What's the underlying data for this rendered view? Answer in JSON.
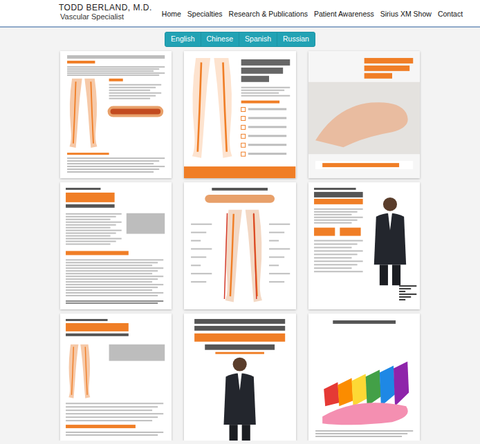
{
  "site": {
    "name": "TODD BERLAND, M.D.",
    "tagline": "Vascular Specialist"
  },
  "nav": [
    {
      "label": "Home"
    },
    {
      "label": "Specialties"
    },
    {
      "label": "Research & Publications"
    },
    {
      "label": "Patient Awareness"
    },
    {
      "label": "Sirius XM Show"
    },
    {
      "label": "Contact"
    }
  ],
  "languages": [
    {
      "label": "English",
      "selected": false
    },
    {
      "label": "Chinese",
      "selected": false
    },
    {
      "label": "Spanish",
      "selected": false
    },
    {
      "label": "Russian",
      "selected": false
    }
  ],
  "posters": [
    {
      "kind": "legs-chart"
    },
    {
      "kind": "feet-promo"
    },
    {
      "kind": "foot-exam"
    },
    {
      "kind": "stats"
    },
    {
      "kind": "anatomy"
    },
    {
      "kind": "doctor-stats"
    },
    {
      "kind": "amputations"
    },
    {
      "kind": "doctor-headline"
    },
    {
      "kind": "angiosomes"
    }
  ]
}
